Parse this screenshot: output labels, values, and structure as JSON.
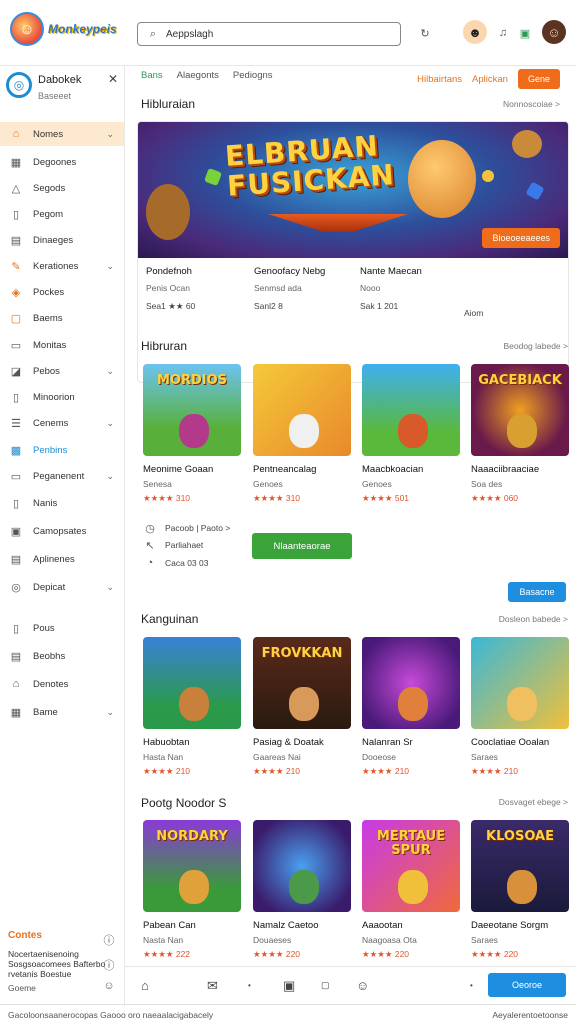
{
  "app": {
    "logo_text": "Monkeypeis"
  },
  "search": {
    "value": "Aeppslagh",
    "placeholder": ""
  },
  "sidebar": {
    "title": "Dabokek",
    "subtitle": "Baseeet",
    "items": [
      {
        "label": "Nomes",
        "icon": "home-icon",
        "chev": true
      },
      {
        "label": "Degoones",
        "icon": "grid-icon",
        "chev": false
      },
      {
        "label": "Segods",
        "icon": "triangle-icon",
        "chev": false
      },
      {
        "label": "Pegom",
        "icon": "doc-icon",
        "chev": false
      },
      {
        "label": "Dinaeges",
        "icon": "calendar-icon",
        "chev": false
      },
      {
        "label": "Kerationes",
        "icon": "puzzle-icon",
        "chev": true
      },
      {
        "label": "Pockes",
        "icon": "bag-icon",
        "chev": false
      },
      {
        "label": "Baems",
        "icon": "square-icon",
        "chev": false
      },
      {
        "label": "Monitas",
        "icon": "monitor-icon",
        "chev": false
      },
      {
        "label": "Pebos",
        "icon": "tag-icon",
        "chev": true
      },
      {
        "label": "Minoorion",
        "icon": "box-icon",
        "chev": false
      },
      {
        "label": "Cenems",
        "icon": "list-icon",
        "chev": true
      },
      {
        "label": "Penbins",
        "icon": "grid-blue-icon",
        "chev": false
      },
      {
        "label": "Peganenent",
        "icon": "card-icon",
        "chev": true
      },
      {
        "label": "Nanis",
        "icon": "note-icon",
        "chev": false
      },
      {
        "label": "Camopsates",
        "icon": "cart-icon",
        "chev": false
      },
      {
        "label": "Aplinenes",
        "icon": "chart-icon",
        "chev": false
      },
      {
        "label": "Depicat",
        "icon": "globe-icon",
        "chev": true
      },
      {
        "label": "Pous",
        "icon": "file-icon",
        "chev": false
      },
      {
        "label": "Beobhs",
        "icon": "book-icon",
        "chev": false
      },
      {
        "label": "Denotes",
        "icon": "lock-icon",
        "chev": false
      },
      {
        "label": "Bame",
        "icon": "table-icon",
        "chev": true
      }
    ],
    "footer": {
      "title": "Contes",
      "text": "Nocertaenisenoing Sosgsoacomees Bafterbo rvetanis Boestue",
      "sub": "Goeme"
    }
  },
  "header": {
    "tabs": [
      "Bans",
      "Alaegonts",
      "Pediogns"
    ],
    "links": [
      "Hilbairtans",
      "Aplickan"
    ],
    "cta": "Gene"
  },
  "featured": {
    "title": "Hibluraian",
    "link": "Nonnoscoiae >",
    "hero_title_line1": "ELBRUAN",
    "hero_title_line2": "FUSICKAN",
    "hero_button": "Bioeoeeaeees",
    "items": [
      {
        "name": "Pondefnoh",
        "sub": "Penis Ocan",
        "meta": "Sea1 ★★ 60"
      },
      {
        "name": "Genoofacy Nebg",
        "sub": "Senmsd ada",
        "meta": "Sanl2 8"
      },
      {
        "name": "Nante Maecan",
        "sub": "Nooo",
        "meta": "Sak 1 201"
      },
      {
        "name": "",
        "sub": "",
        "meta": "Aiom"
      }
    ]
  },
  "section2": {
    "title": "Hibruran",
    "link": "Beodog labede >",
    "games": [
      {
        "name": "Meonime Goaan",
        "sub": "Senesa",
        "rating": "★★★★ 310",
        "art": "MORDIOS"
      },
      {
        "name": "Pentneancalag",
        "sub": "Genoes",
        "rating": "★★★★ 310",
        "art": ""
      },
      {
        "name": "Maacbkoacian",
        "sub": "Genoes",
        "rating": "★★★★ 501",
        "art": ""
      },
      {
        "name": "Naaaciibraaciae",
        "sub": "Soa des",
        "rating": "★★★★ 060",
        "art": "GACEBIACK"
      }
    ],
    "rows": [
      "Pacoob | Paoto >",
      "Parliahaet",
      "Caca 03 03"
    ],
    "green_button": "Nlaanteaorae"
  },
  "blue_button": "Basacne",
  "section3": {
    "title": "Kanguinan",
    "link": "Dosleon babede >",
    "games": [
      {
        "name": "Habuobtan",
        "sub": "Hasta Nan",
        "rating": "★★★★ 210",
        "art": ""
      },
      {
        "name": "Pasiag & Doatak",
        "sub": "Gaareas Nai",
        "rating": "★★★★ 210",
        "art": "FROVKKAN"
      },
      {
        "name": "Nalanran Sr",
        "sub": "Dooeose",
        "rating": "★★★★ 210",
        "art": ""
      },
      {
        "name": "Cooclatiae Ooalan",
        "sub": "Saraes",
        "rating": "★★★★ 210",
        "art": ""
      }
    ]
  },
  "section4": {
    "title": "Pootg Noodor S",
    "link": "Dosvaget ebege >",
    "games": [
      {
        "name": "Pabean Can",
        "sub": "Nasta Nan",
        "rating": "★★★★ 222",
        "art": "NORDARY"
      },
      {
        "name": "Namalz Caetoo",
        "sub": "Douaeses",
        "rating": "★★★★ 220",
        "art": ""
      },
      {
        "name": "Aaaootan",
        "sub": "Naagoasa Ota",
        "rating": "★★★★ 220",
        "art": "MERTAUE SPUR"
      },
      {
        "name": "Daeeotane Sorgm",
        "sub": "Saraes",
        "rating": "★★★★ 220",
        "art": "KLOSOAE"
      }
    ]
  },
  "bottom": {
    "button": "Oeoroe"
  },
  "footer": {
    "left": "Gacoloonsaanerocopas  Gaooo oro naeaalacigabacely",
    "right": "Aeyalerentoetoonse"
  }
}
